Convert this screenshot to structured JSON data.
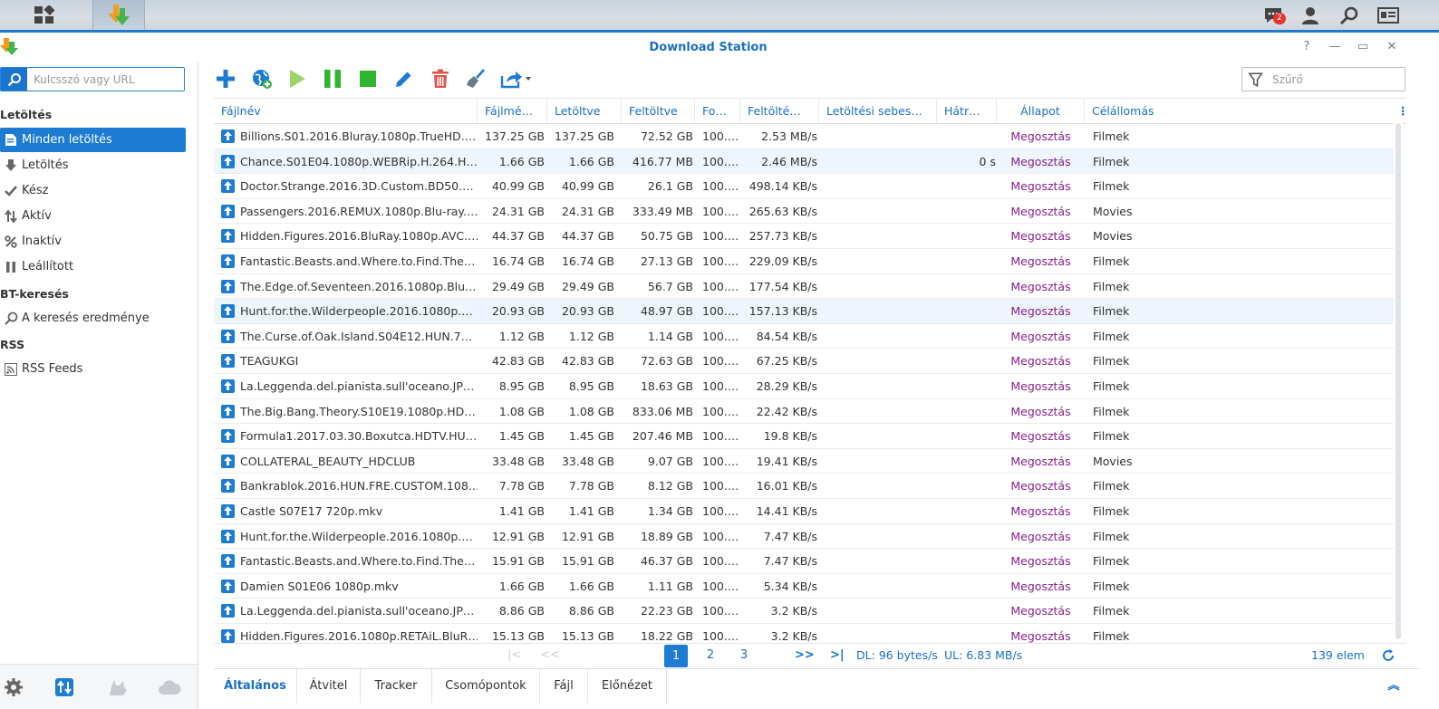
{
  "taskbar": {
    "notification_count": "2"
  },
  "window": {
    "title": "Download Station",
    "help": "?",
    "minimize": "—",
    "maximize": "▭",
    "close": "✕"
  },
  "sidebar": {
    "search_placeholder": "Kulcsszó vagy URL",
    "sections": {
      "downloads": "Letöltés",
      "bt_search": "BT-keresés",
      "rss": "RSS"
    },
    "items": [
      {
        "label": "Minden letöltés",
        "icon": "list-icon",
        "selected": true
      },
      {
        "label": "Letöltés",
        "icon": "download-arrow-icon"
      },
      {
        "label": "Kész",
        "icon": "check-icon"
      },
      {
        "label": "Aktív",
        "icon": "updown-arrows-icon"
      },
      {
        "label": "Inaktív",
        "icon": "percent-icon"
      },
      {
        "label": "Leállított",
        "icon": "pause-icon"
      },
      {
        "label": "A keresés eredménye",
        "icon": "search-icon"
      },
      {
        "label": "RSS Feeds",
        "icon": "rss-icon"
      }
    ]
  },
  "toolbar": {
    "filter_placeholder": "Szűrő"
  },
  "columns": [
    "Fájlnév",
    "Fájlmé…",
    "Letöltve",
    "Feltöltve",
    "Fo…",
    "Feltölté…",
    "Letöltési sebes…",
    "Hátr…",
    "Állapot",
    "Célállomás"
  ],
  "rows": [
    {
      "name": "Billions.S01.2016.Bluray.1080p.TrueHD.…",
      "size": "137.25 GB",
      "downloaded": "137.25 GB",
      "uploaded": "72.52 GB",
      "progress": "100.…",
      "up_speed": "2.53 MB/s",
      "dl_speed": "",
      "remaining": "",
      "status": "Megosztás",
      "dest": "Filmek"
    },
    {
      "name": "Chance.S01E04.1080p.WEBRip.H.264.H…",
      "size": "1.66 GB",
      "downloaded": "1.66 GB",
      "uploaded": "416.77 MB",
      "progress": "100.…",
      "up_speed": "2.46 MB/s",
      "dl_speed": "",
      "remaining": "0 s",
      "status": "Megosztás",
      "dest": "Filmek"
    },
    {
      "name": "Doctor.Strange.2016.3D.Custom.BD50.…",
      "size": "40.99 GB",
      "downloaded": "40.99 GB",
      "uploaded": "26.1 GB",
      "progress": "100.…",
      "up_speed": "498.14 KB/s",
      "dl_speed": "",
      "remaining": "",
      "status": "Megosztás",
      "dest": "Filmek"
    },
    {
      "name": "Passengers.2016.REMUX.1080p.Blu-ray.…",
      "size": "24.31 GB",
      "downloaded": "24.31 GB",
      "uploaded": "333.49 MB",
      "progress": "100.…",
      "up_speed": "265.63 KB/s",
      "dl_speed": "",
      "remaining": "",
      "status": "Megosztás",
      "dest": "Movies"
    },
    {
      "name": "Hidden.Figures.2016.BluRay.1080p.AVC.…",
      "size": "44.37 GB",
      "downloaded": "44.37 GB",
      "uploaded": "50.75 GB",
      "progress": "100.…",
      "up_speed": "257.73 KB/s",
      "dl_speed": "",
      "remaining": "",
      "status": "Megosztás",
      "dest": "Movies"
    },
    {
      "name": "Fantastic.Beasts.and.Where.to.Find.The…",
      "size": "16.74 GB",
      "downloaded": "16.74 GB",
      "uploaded": "27.13 GB",
      "progress": "100.…",
      "up_speed": "229.09 KB/s",
      "dl_speed": "",
      "remaining": "",
      "status": "Megosztás",
      "dest": "Filmek"
    },
    {
      "name": "The.Edge.of.Seventeen.2016.1080p.Blu…",
      "size": "29.49 GB",
      "downloaded": "29.49 GB",
      "uploaded": "56.7 GB",
      "progress": "100.…",
      "up_speed": "177.54 KB/s",
      "dl_speed": "",
      "remaining": "",
      "status": "Megosztás",
      "dest": "Filmek"
    },
    {
      "name": "Hunt.for.the.Wilderpeople.2016.1080p.…",
      "size": "20.93 GB",
      "downloaded": "20.93 GB",
      "uploaded": "48.97 GB",
      "progress": "100.…",
      "up_speed": "157.13 KB/s",
      "dl_speed": "",
      "remaining": "",
      "status": "Megosztás",
      "dest": "Filmek"
    },
    {
      "name": "The.Curse.of.Oak.Island.S04E12.HUN.7…",
      "size": "1.12 GB",
      "downloaded": "1.12 GB",
      "uploaded": "1.14 GB",
      "progress": "100.…",
      "up_speed": "84.54 KB/s",
      "dl_speed": "",
      "remaining": "",
      "status": "Megosztás",
      "dest": "Filmek"
    },
    {
      "name": "TEAGUKGI",
      "size": "42.83 GB",
      "downloaded": "42.83 GB",
      "uploaded": "72.63 GB",
      "progress": "100.…",
      "up_speed": "67.25 KB/s",
      "dl_speed": "",
      "remaining": "",
      "status": "Megosztás",
      "dest": "Filmek"
    },
    {
      "name": "La.Leggenda.del.pianista.sull'oceano.JP…",
      "size": "8.95 GB",
      "downloaded": "8.95 GB",
      "uploaded": "18.63 GB",
      "progress": "100.…",
      "up_speed": "28.29 KB/s",
      "dl_speed": "",
      "remaining": "",
      "status": "Megosztás",
      "dest": "Filmek"
    },
    {
      "name": "The.Big.Bang.Theory.S10E19.1080p.HD…",
      "size": "1.08 GB",
      "downloaded": "1.08 GB",
      "uploaded": "833.06 MB",
      "progress": "100.…",
      "up_speed": "22.42 KB/s",
      "dl_speed": "",
      "remaining": "",
      "status": "Megosztás",
      "dest": "Filmek"
    },
    {
      "name": "Formula1.2017.03.30.Boxutca.HDTV.HU…",
      "size": "1.45 GB",
      "downloaded": "1.45 GB",
      "uploaded": "207.46 MB",
      "progress": "100.…",
      "up_speed": "19.8 KB/s",
      "dl_speed": "",
      "remaining": "",
      "status": "Megosztás",
      "dest": "Filmek"
    },
    {
      "name": "COLLATERAL_BEAUTY_HDCLUB",
      "size": "33.48 GB",
      "downloaded": "33.48 GB",
      "uploaded": "9.07 GB",
      "progress": "100.…",
      "up_speed": "19.41 KB/s",
      "dl_speed": "",
      "remaining": "",
      "status": "Megosztás",
      "dest": "Movies"
    },
    {
      "name": "Bankrablok.2016.HUN.FRE.CUSTOM.108…",
      "size": "7.78 GB",
      "downloaded": "7.78 GB",
      "uploaded": "8.12 GB",
      "progress": "100.…",
      "up_speed": "16.01 KB/s",
      "dl_speed": "",
      "remaining": "",
      "status": "Megosztás",
      "dest": "Filmek"
    },
    {
      "name": "Castle S07E17 720p.mkv",
      "size": "1.41 GB",
      "downloaded": "1.41 GB",
      "uploaded": "1.34 GB",
      "progress": "100.…",
      "up_speed": "14.41 KB/s",
      "dl_speed": "",
      "remaining": "",
      "status": "Megosztás",
      "dest": "Filmek"
    },
    {
      "name": "Hunt.for.the.Wilderpeople.2016.1080p.…",
      "size": "12.91 GB",
      "downloaded": "12.91 GB",
      "uploaded": "18.89 GB",
      "progress": "100.…",
      "up_speed": "7.47 KB/s",
      "dl_speed": "",
      "remaining": "",
      "status": "Megosztás",
      "dest": "Filmek"
    },
    {
      "name": "Fantastic.Beasts.and.Where.to.Find.The…",
      "size": "15.91 GB",
      "downloaded": "15.91 GB",
      "uploaded": "46.37 GB",
      "progress": "100.…",
      "up_speed": "7.47 KB/s",
      "dl_speed": "",
      "remaining": "",
      "status": "Megosztás",
      "dest": "Filmek"
    },
    {
      "name": "Damien S01E06 1080p.mkv",
      "size": "1.66 GB",
      "downloaded": "1.66 GB",
      "uploaded": "1.11 GB",
      "progress": "100.…",
      "up_speed": "5.34 KB/s",
      "dl_speed": "",
      "remaining": "",
      "status": "Megosztás",
      "dest": "Filmek"
    },
    {
      "name": "La.Leggenda.del.pianista.sull'oceano.JP…",
      "size": "8.86 GB",
      "downloaded": "8.86 GB",
      "uploaded": "22.23 GB",
      "progress": "100.…",
      "up_speed": "3.2 KB/s",
      "dl_speed": "",
      "remaining": "",
      "status": "Megosztás",
      "dest": "Filmek"
    },
    {
      "name": "Hidden.Figures.2016.1080p.RETAiL.BluR…",
      "size": "15.13 GB",
      "downloaded": "15.13 GB",
      "uploaded": "18.22 GB",
      "progress": "100.…",
      "up_speed": "3.2 KB/s",
      "dl_speed": "",
      "remaining": "",
      "status": "Megosztás",
      "dest": "Filmek"
    }
  ],
  "pager": {
    "pages": [
      "1",
      "2",
      "3"
    ],
    "current": "1",
    "dl_speed": "DL: 96 bytes/s",
    "ul_speed": "UL: 6.83 MB/s",
    "total": "139 elem"
  },
  "bottom_tabs": [
    "Általános",
    "Átvitel",
    "Tracker",
    "Csomópontok",
    "Fájl",
    "Előnézet"
  ],
  "colors": {
    "accent": "#1c7bd3",
    "status": "#8b1e8b",
    "play": "#9ed36a",
    "pause": "#2fb52f",
    "stop": "#2fb52f",
    "delete": "#e0534a"
  }
}
